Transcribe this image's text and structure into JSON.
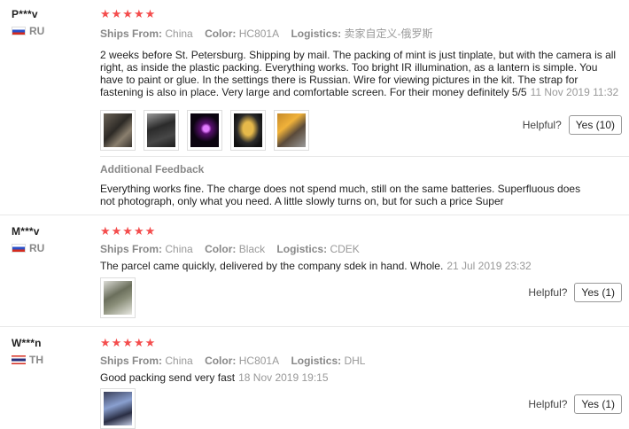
{
  "labels": {
    "ships_from": "Ships From:",
    "color": "Color:",
    "logistics": "Logistics:",
    "helpful": "Helpful?",
    "additional_feedback": "Additional Feedback"
  },
  "stars": "★★★★★",
  "reviews": [
    {
      "user": "P***v",
      "country": "RU",
      "rating": 5,
      "ships_from": "China",
      "color": "HC801A",
      "logistics": "卖家自定义-俄罗斯",
      "text": "2 weeks before St. Petersburg. Shipping by mail. The packing of mint is just tinplate, but with the camera is all right, as inside the plastic packing. Everything works. Too bright IR illumination, as a lantern is simple. You have to paint or glue. In the settings there is Russian. Wire for viewing pictures in the kit. The strap for fastening is also in place. Very large and comfortable screen. For their money definitely 5/5",
      "date": "11 Nov 2019 11:32",
      "yes": "Yes (10)",
      "additional_feedback": "Everything works fine. The charge does not spend much, still on the same batteries. Superfluous does not photograph, only what you need. A little slowly turns on, but for such a price Super"
    },
    {
      "user": "M***v",
      "country": "RU",
      "rating": 5,
      "ships_from": "China",
      "color": "Black",
      "logistics": "CDEK",
      "text": "The parcel came quickly, delivered by the company sdek in hand. Whole.",
      "date": "21 Jul 2019 23:32",
      "yes": "Yes (1)"
    },
    {
      "user": "W***n",
      "country": "TH",
      "rating": 5,
      "ships_from": "China",
      "color": "HC801A",
      "logistics": "DHL",
      "text": "Good packing send very fast",
      "date": "18 Nov 2019 19:15",
      "yes": "Yes (1)"
    }
  ],
  "colors": {
    "star": "#f44d4d",
    "muted": "#888888",
    "text": "#222222"
  }
}
